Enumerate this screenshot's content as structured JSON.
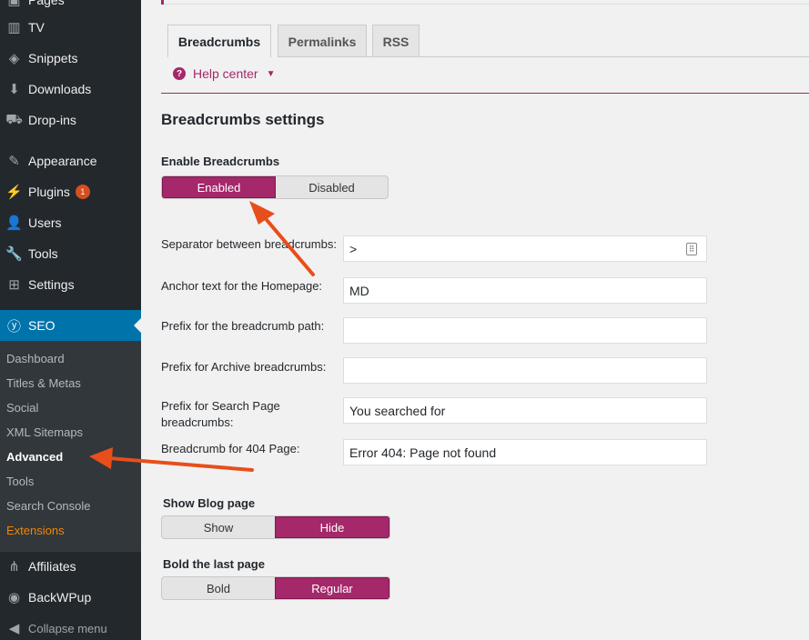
{
  "sidebar": {
    "items": [
      {
        "label": "Pages",
        "icon": "pages-icon",
        "glyph": "▣"
      },
      {
        "label": "TV",
        "icon": "film-icon",
        "glyph": "▥"
      },
      {
        "label": "Snippets",
        "icon": "snippet-icon",
        "glyph": "◈"
      },
      {
        "label": "Downloads",
        "icon": "download-icon",
        "glyph": "⬇"
      },
      {
        "label": "Drop-ins",
        "icon": "cart-icon",
        "glyph": "⛟"
      },
      {
        "label": "Appearance",
        "icon": "paintbrush-icon",
        "glyph": "✎"
      },
      {
        "label": "Plugins",
        "icon": "plugin-icon",
        "glyph": "⚡",
        "badge": "1"
      },
      {
        "label": "Users",
        "icon": "user-icon",
        "glyph": "👤"
      },
      {
        "label": "Tools",
        "icon": "wrench-icon",
        "glyph": "🔧"
      },
      {
        "label": "Settings",
        "icon": "settings-icon",
        "glyph": "⊞"
      },
      {
        "label": "SEO",
        "icon": "yoast-icon",
        "glyph": "ⓨ"
      }
    ],
    "submenu": [
      "Dashboard",
      "Titles & Metas",
      "Social",
      "XML Sitemaps",
      "Advanced",
      "Tools",
      "Search Console",
      "Extensions"
    ],
    "bottom": [
      {
        "label": "Affiliates",
        "icon": "share-icon",
        "glyph": "⋔"
      },
      {
        "label": "BackWPup",
        "icon": "backwpup-icon",
        "glyph": "◉"
      },
      {
        "label": "Collapse menu",
        "icon": "collapse-icon",
        "glyph": "◀"
      }
    ]
  },
  "tabs": [
    "Breadcrumbs",
    "Permalinks",
    "RSS"
  ],
  "help": {
    "label": "Help center",
    "caret": "▼",
    "q": "?"
  },
  "section_title": "Breadcrumbs settings",
  "enable": {
    "label": "Enable Breadcrumbs",
    "on": "Enabled",
    "off": "Disabled"
  },
  "fields": [
    {
      "label": "Separator between breadcrumbs:",
      "value": ">"
    },
    {
      "label": "Anchor text for the Homepage:",
      "value": "MD"
    },
    {
      "label": "Prefix for the breadcrumb path:",
      "value": ""
    },
    {
      "label": "Prefix for Archive breadcrumbs:",
      "value": ""
    },
    {
      "label": "Prefix for Search Page breadcrumbs:",
      "value": "You searched for"
    },
    {
      "label": "Breadcrumb for 404 Page:",
      "value": "Error 404: Page not found"
    }
  ],
  "blog": {
    "label": "Show Blog page",
    "a": "Show",
    "b": "Hide"
  },
  "bold": {
    "label": "Bold the last page",
    "a": "Bold",
    "b": "Regular"
  },
  "colors": {
    "accent": "#a4286a",
    "sidebar": "#23282d",
    "current": "#0073aa",
    "arrow": "#e84e1b"
  }
}
